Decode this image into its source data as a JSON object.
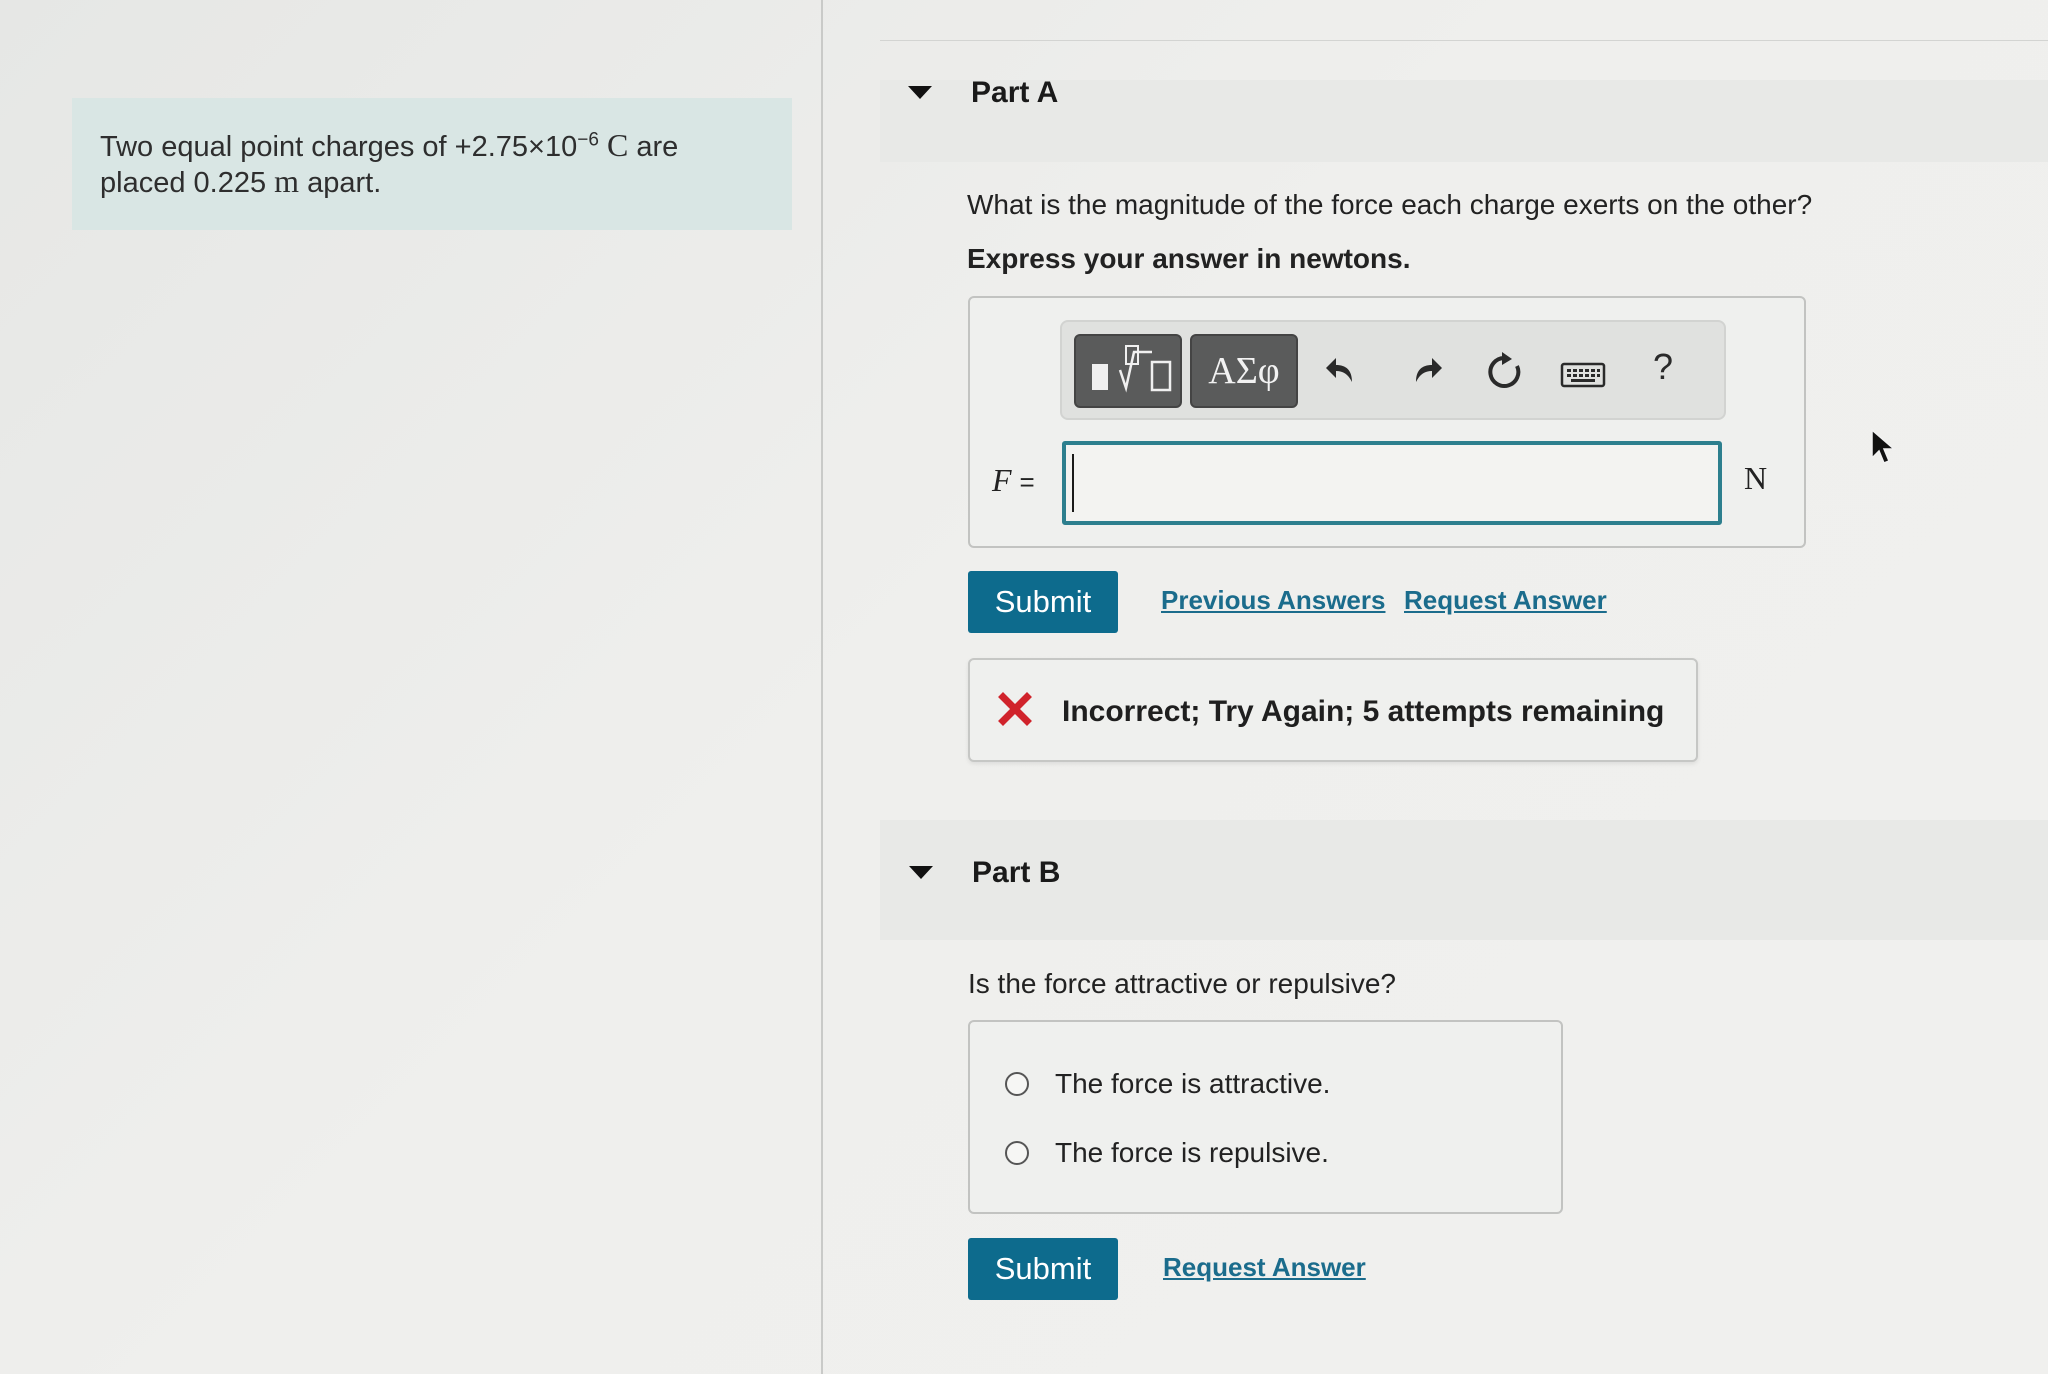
{
  "problem": {
    "text_before": "Two equal point charges of +2.75×10",
    "exponent": "−6",
    "unit_charge": "C",
    "text_mid": " are",
    "text_line2": "placed 0.225 ",
    "unit_distance": "m",
    "text_end": " apart."
  },
  "part_a": {
    "title": "Part A",
    "question": "What is the magnitude of the force each charge exerts on the other?",
    "instruction": "Express your answer in newtons.",
    "toolbar": {
      "templates_icon": "▮√▯",
      "greek_label": "ΑΣφ",
      "help_label": "?"
    },
    "variable": "F",
    "equals": "=",
    "answer_value": "",
    "unit": "N",
    "submit_label": "Submit",
    "previous_answers_label": "Previous Answers",
    "request_answer_label": "Request Answer",
    "feedback": "Incorrect; Try Again; 5 attempts remaining"
  },
  "part_b": {
    "title": "Part B",
    "question": "Is the force attractive or repulsive?",
    "options": [
      "The force is attractive.",
      "The force is repulsive."
    ],
    "submit_label": "Submit",
    "request_answer_label": "Request Answer"
  },
  "colors": {
    "problem_bg": "#d9e6e4",
    "submit_bg": "#0d6b8d",
    "link": "#1b6c8c",
    "input_border": "#2d7f8e",
    "error": "#d0232b"
  }
}
